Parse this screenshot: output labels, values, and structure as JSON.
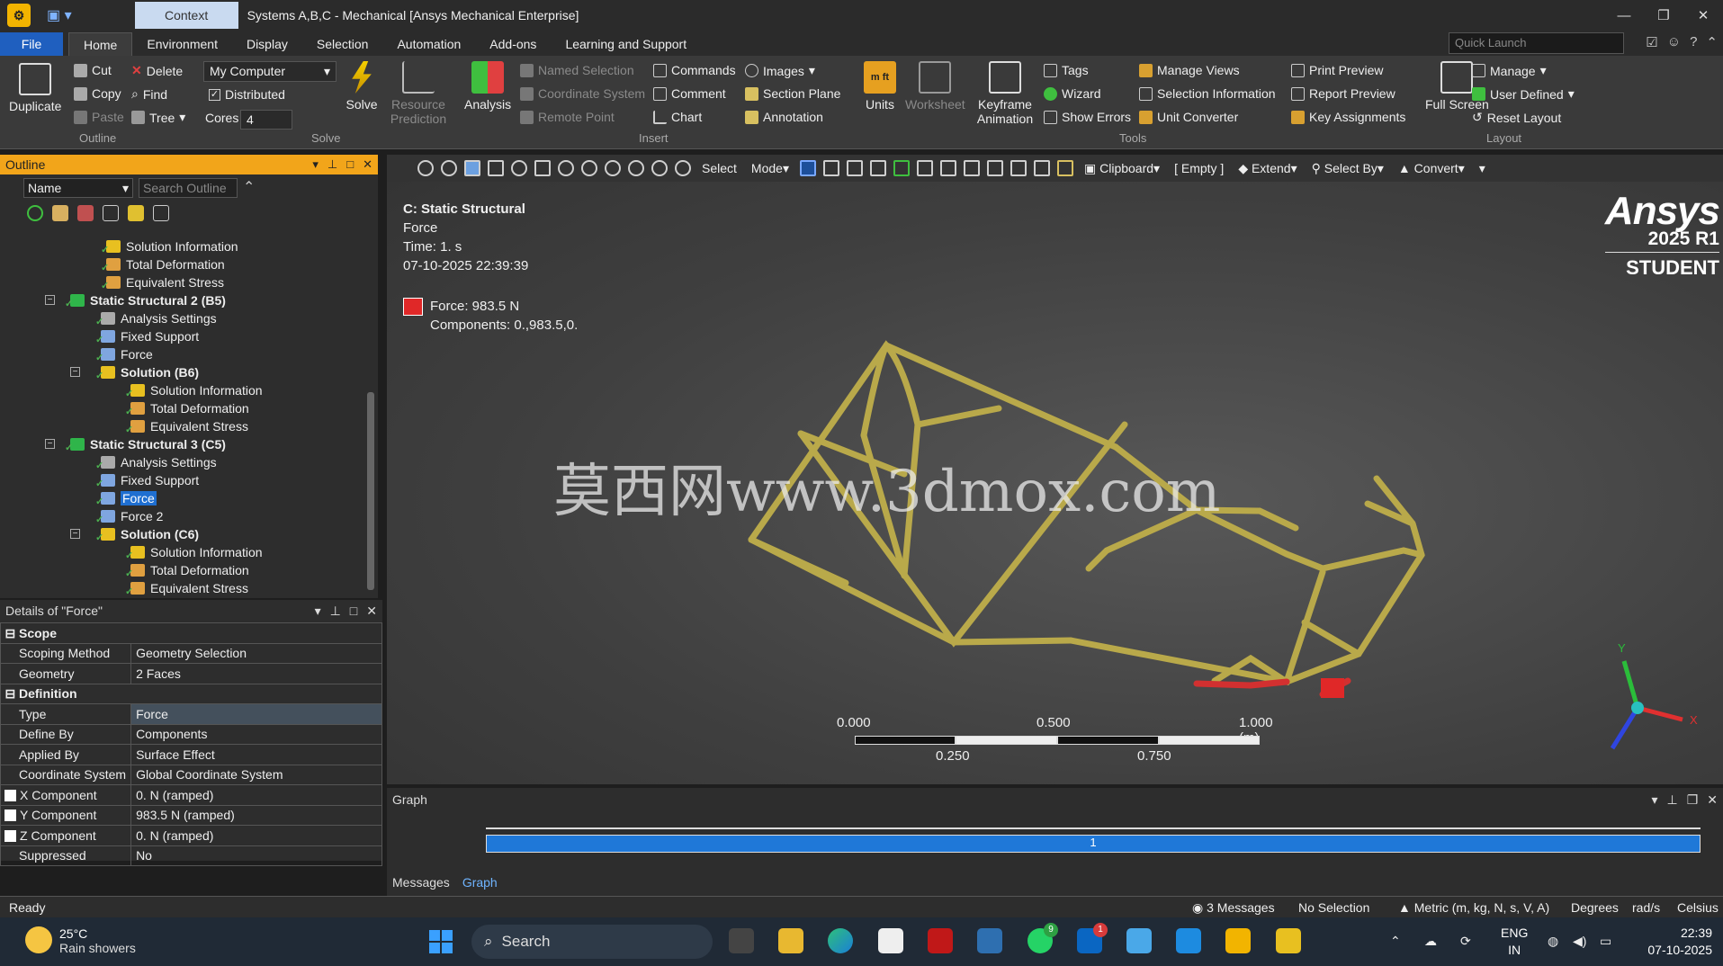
{
  "window": {
    "context_tab": "Context",
    "title": "Systems A,B,C - Mechanical [Ansys Mechanical Enterprise]"
  },
  "menu": {
    "file": "File",
    "tabs": [
      "Home",
      "Environment",
      "Display",
      "Selection",
      "Automation",
      "Add-ons",
      "Learning and Support"
    ],
    "quick_launch_placeholder": "Quick Launch"
  },
  "ribbon": {
    "outline": {
      "duplicate": "Duplicate",
      "cut": "Cut",
      "copy": "Copy",
      "paste": "Paste",
      "delete": "Delete",
      "find": "Find",
      "tree": "Tree",
      "label": "Outline"
    },
    "solve": {
      "computer": "My Computer",
      "distributed": "Distributed",
      "cores_label": "Cores",
      "cores_value": "4",
      "solve": "Solve",
      "resource_prediction": "Resource Prediction",
      "label": "Solve"
    },
    "insert": {
      "analysis": "Analysis",
      "named_selection": "Named Selection",
      "coordinate_system": "Coordinate System",
      "remote_point": "Remote Point",
      "commands": "Commands",
      "comment": "Comment",
      "chart": "Chart",
      "images": "Images",
      "section_plane": "Section Plane",
      "annotation": "Annotation",
      "label": "Insert"
    },
    "tools": {
      "units": "Units",
      "worksheet": "Worksheet",
      "keyframe_animation": "Keyframe Animation",
      "tags": "Tags",
      "wizard": "Wizard",
      "show_errors": "Show Errors",
      "manage_views": "Manage Views",
      "selection_information": "Selection Information",
      "unit_converter": "Unit Converter",
      "print_preview": "Print Preview",
      "report_preview": "Report Preview",
      "key_assignments": "Key Assignments",
      "label": "Tools"
    },
    "layout": {
      "full_screen": "Full Screen",
      "manage": "Manage",
      "user_defined": "User Defined",
      "reset_layout": "Reset Layout",
      "label": "Layout"
    }
  },
  "outline": {
    "title": "Outline",
    "name_filter": "Name",
    "search_placeholder": "Search Outline",
    "items": [
      "Solution Information",
      "Total Deformation",
      "Equivalent Stress",
      "Static Structural 2 (B5)",
      "Analysis Settings",
      "Fixed Support",
      "Force",
      "Solution (B6)",
      "Solution Information",
      "Total Deformation",
      "Equivalent Stress",
      "Static Structural 3 (C5)",
      "Analysis Settings",
      "Fixed Support",
      "Force",
      "Force 2",
      "Solution (C6)",
      "Solution Information",
      "Total Deformation",
      "Equivalent Stress"
    ]
  },
  "details": {
    "title": "Details of \"Force\"",
    "scope_label": "Scope",
    "definition_label": "Definition",
    "rows": [
      {
        "k": "Scoping Method",
        "v": "Geometry Selection"
      },
      {
        "k": "Geometry",
        "v": "2 Faces"
      },
      {
        "k": "Type",
        "v": "Force"
      },
      {
        "k": "Define By",
        "v": "Components"
      },
      {
        "k": "Applied By",
        "v": "Surface Effect"
      },
      {
        "k": "Coordinate System",
        "v": "Global Coordinate System"
      },
      {
        "k": "X Component",
        "v": "0. N  (ramped)"
      },
      {
        "k": "Y Component",
        "v": "983.5 N  (ramped)"
      },
      {
        "k": "Z Component",
        "v": "0. N  (ramped)"
      },
      {
        "k": "Suppressed",
        "v": "No"
      }
    ]
  },
  "viewport_toolbar": {
    "select": "Select",
    "mode": "Mode",
    "clipboard": "Clipboard",
    "empty": "[ Empty ]",
    "extend": "Extend",
    "select_by": "Select By",
    "convert": "Convert"
  },
  "viewport": {
    "analysis": "C: Static Structural",
    "object": "Force",
    "time": "Time: 1. s",
    "date": "07-10-2025 22:39:39",
    "legend_value": "Force: 983.5 N",
    "legend_components": "Components: 0.,983.5,0.",
    "logo_brand": "Ansys",
    "logo_release": "2025 R1",
    "logo_edition": "STUDENT",
    "watermark": "莫西网www.3dmox.com",
    "scale": {
      "top": [
        "0.000",
        "0.500",
        "1.000 (m)"
      ],
      "bottom": [
        "0.250",
        "0.750"
      ]
    },
    "triad": {
      "x": "X",
      "y": "Y"
    }
  },
  "graph": {
    "title": "Graph",
    "step": "1",
    "tabs": [
      "Messages",
      "Graph"
    ]
  },
  "status": {
    "ready": "Ready",
    "messages": "3 Messages",
    "selection": "No Selection",
    "units": "Metric (m, kg, N, s, V, A)",
    "angle": "Degrees",
    "rot": "rad/s",
    "temp": "Celsius"
  },
  "taskbar": {
    "temp": "25°C",
    "weather": "Rain showers",
    "search": "Search",
    "lang1": "ENG",
    "lang2": "IN",
    "time": "22:39",
    "date": "07-10-2025",
    "badges": [
      "9",
      "1"
    ]
  },
  "colors": {
    "accent": "#f2a51a",
    "file_blue": "#1f5fbf",
    "frame": "#b9a94a",
    "force": "#e02828"
  }
}
